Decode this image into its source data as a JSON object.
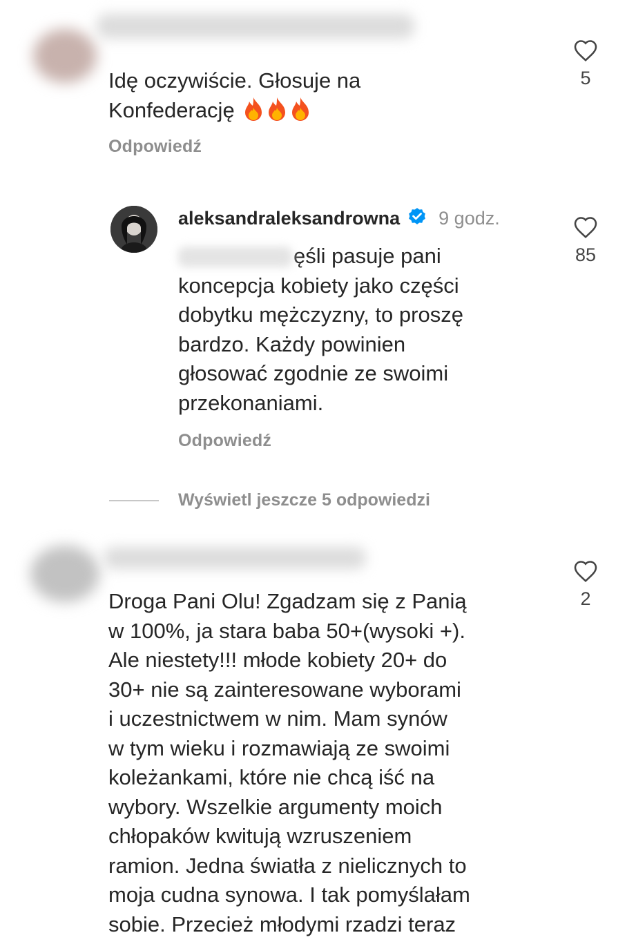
{
  "comments": [
    {
      "text_before": "Idę oczywiście. Głosuje na",
      "text_line2": "Konfederację",
      "emoji": [
        "fire",
        "fire",
        "fire"
      ],
      "reply_label": "Odpowiedź",
      "likes": "5"
    },
    {
      "username": "aleksandraleksandrowna",
      "verified": true,
      "time": "9 godz.",
      "text": "jeśli pasuje pani koncepcja kobiety jako części dobytku mężczyzny, to proszę bardzo. Każdy powinien głosować zgodnie ze swoimi przekonaniami.",
      "text_lines": [
        "ęśli pasuje pani",
        "koncepcja kobiety jako części",
        "dobytku mężczyzny, to proszę",
        "bardzo. Każdy powinien",
        "głosować zgodnie ze swoimi",
        "przekonaniami."
      ],
      "reply_label": "Odpowiedź",
      "likes": "85"
    },
    {
      "text_lines": [
        "Droga Pani Olu! Zgadzam się z Panią",
        "w 100%, ja stara baba 50+(wysoki +).",
        "Ale niestety!!! młode kobiety 20+ do",
        "30+ nie są zainteresowane wyborami",
        "i uczestnictwem w nim. Mam synów",
        "w tym wieku i rozmawiają ze swoimi",
        "koleżankami, które nie chcą iść na",
        "wybory. Wszelkie argumenty moich",
        "chłopaków kwitują wzruszeniem",
        "ramion. Jedna światła z nielicznych to",
        "moja cudna synowa. I tak pomyślałam",
        "sobie. Przecież młodymi rzadzi teraz"
      ],
      "likes": "2"
    }
  ],
  "view_more_label": "Wyświetl jeszcze 5 odpowiedzi",
  "icons": {
    "like": "heart-outline-icon",
    "verified": "verified-badge-icon",
    "emoji": "fire-emoji-icon"
  },
  "colors": {
    "text": "#262626",
    "muted": "#8e8e8e",
    "verified": "#0095f6"
  }
}
